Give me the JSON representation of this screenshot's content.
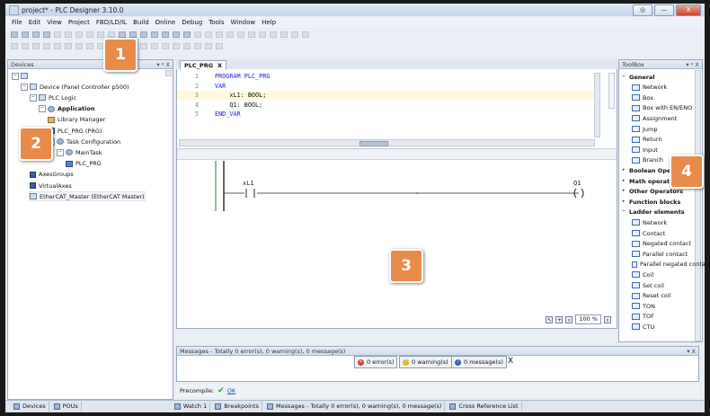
{
  "window": {
    "title": "project* - PLC Designer 3.10.0",
    "controls": [
      "◎",
      "—",
      "X"
    ]
  },
  "menu": [
    "File",
    "Edit",
    "View",
    "Project",
    "FBD/LD/IL",
    "Build",
    "Online",
    "Debug",
    "Tools",
    "Window",
    "Help"
  ],
  "devices": {
    "title": "Devices",
    "controls": "▾ ᵖ X",
    "items": [
      {
        "label": "",
        "indent": 0,
        "icon": "project-icon",
        "exp": "−"
      },
      {
        "label": "Device (Panel Controller p500)",
        "indent": 1,
        "icon": "device-icon",
        "exp": "−"
      },
      {
        "label": "PLC Logic",
        "indent": 2,
        "icon": "plc-icon",
        "exp": "−"
      },
      {
        "label": "Application",
        "indent": 3,
        "icon": "application-icon",
        "exp": "−",
        "bold": true
      },
      {
        "label": "Library Manager",
        "indent": 4,
        "icon": "library-icon"
      },
      {
        "label": "PLC_PRG (PRG)",
        "indent": 4,
        "icon": "pou-icon"
      },
      {
        "label": "Task Configuration",
        "indent": 4,
        "icon": "task-icon",
        "exp": "−"
      },
      {
        "label": "MainTask",
        "indent": 5,
        "icon": "task-icon",
        "exp": "−"
      },
      {
        "label": "PLC_PRG",
        "indent": 6,
        "icon": "pou-icon"
      },
      {
        "label": "AxesGroups",
        "indent": 2,
        "icon": "axis-icon"
      },
      {
        "label": "VirtualAxes",
        "indent": 2,
        "icon": "axis-icon"
      },
      {
        "label": "EtherCAT_Master (EtherCAT Master)",
        "indent": 2,
        "icon": "ethercat-icon",
        "selected": true
      }
    ],
    "bottom_tabs": [
      "Devices",
      "POUs"
    ]
  },
  "editor": {
    "tab": "PLC_PRG",
    "tab_close": "X",
    "code": [
      {
        "ln": "1",
        "text": "PROGRAM PLC_PRG",
        "kw": true
      },
      {
        "ln": "2",
        "text": "VAR",
        "kw": true
      },
      {
        "ln": "3",
        "text": "    xL1: BOOL;",
        "hl": true
      },
      {
        "ln": "4",
        "text": "    Q1: BOOL;"
      },
      {
        "ln": "5",
        "text": "END_VAR",
        "kw": true
      }
    ],
    "ladder": {
      "contact": "xL1",
      "coil": "Q1"
    },
    "zoom": "100 %"
  },
  "toolbox": {
    "title": "ToolBox",
    "controls": "▾ ᵖ X",
    "sections": [
      {
        "name": "General",
        "open": true,
        "items": [
          "Network",
          "Box",
          "Box with EN/ENO",
          "Assignment",
          "Jump",
          "Return",
          "Input",
          "Branch"
        ]
      },
      {
        "name": "Boolean Operators",
        "open": false,
        "items": []
      },
      {
        "name": "Math operators",
        "open": false,
        "items": []
      },
      {
        "name": "Other Operators",
        "open": false,
        "items": []
      },
      {
        "name": "Function blocks",
        "open": false,
        "items": []
      },
      {
        "name": "Ladder elements",
        "open": true,
        "items": [
          "Network",
          "Contact",
          "Negated contact",
          "Parallel contact",
          "Parallel negated contact",
          "Coil",
          "Set coil",
          "Reset coil",
          "TON",
          "TOF",
          "CTU"
        ]
      }
    ]
  },
  "messages": {
    "title": "Messages - Totally 0 error(s), 0 warning(s), 0 message(s)",
    "errors": "0 error(s)",
    "warnings": "0 warning(s)",
    "infos": "0 message(s)",
    "clear": "X",
    "controls": "▾ X"
  },
  "precompile": {
    "label": "Precompile:",
    "status": "OK"
  },
  "statusbar": [
    "Watch 1",
    "Breakpoints",
    "Messages - Totally 0 error(s), 0 warning(s), 0 message(s)",
    "Cross Reference List"
  ],
  "callouts": [
    "1",
    "2",
    "3",
    "4"
  ],
  "colors": {
    "accent": "#e88b4a",
    "keyword": "#1b1bd6",
    "ok": "#2a9a2a"
  }
}
